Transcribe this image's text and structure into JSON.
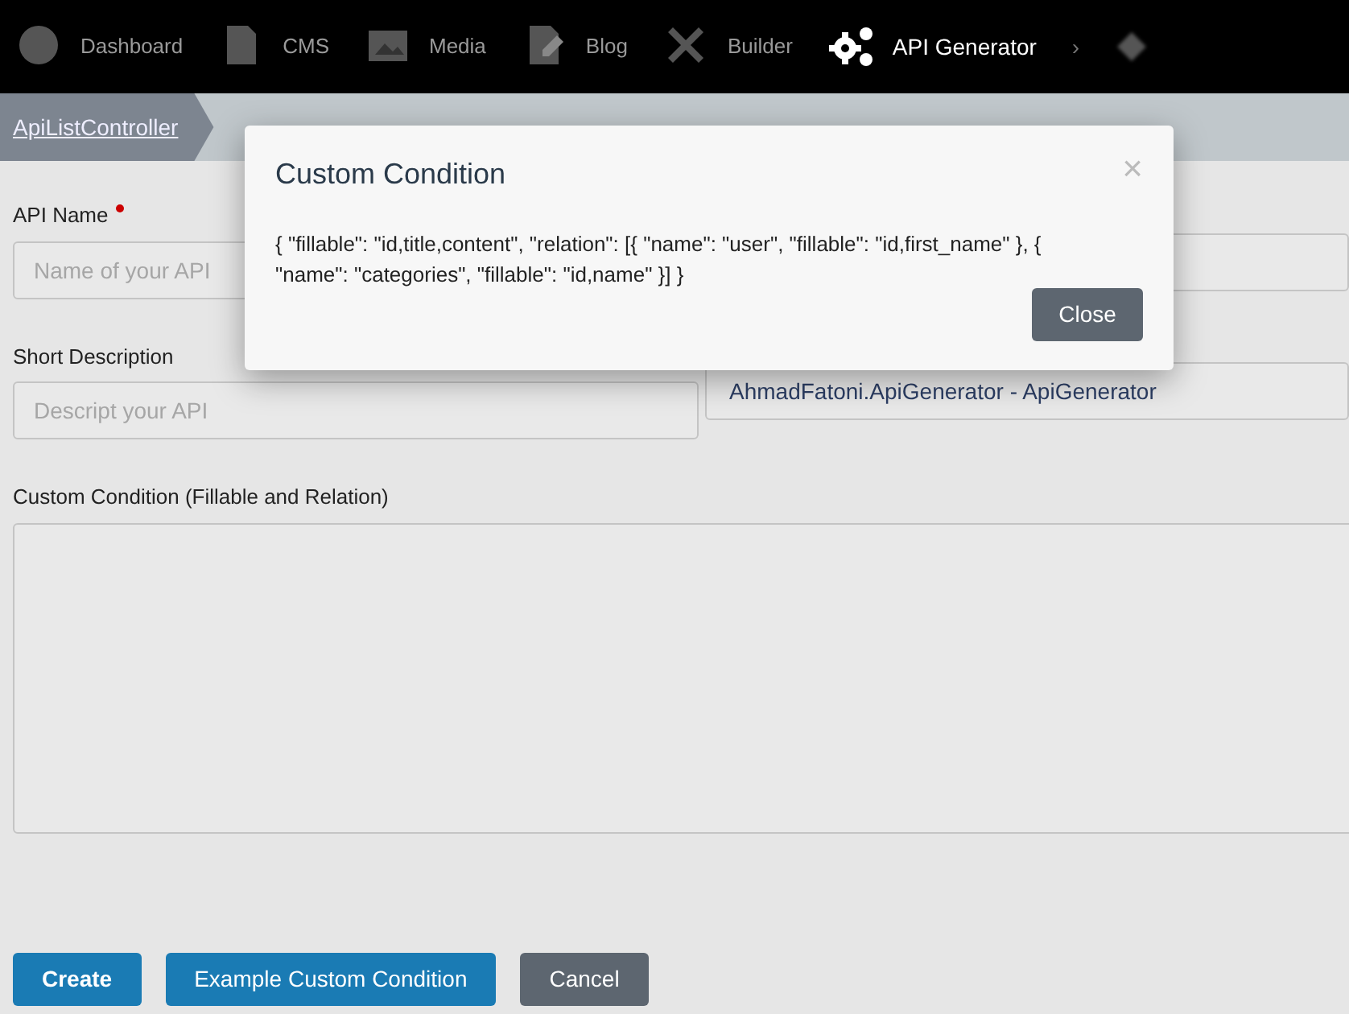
{
  "navbar": {
    "items": [
      {
        "label": "Dashboard",
        "selected": false
      },
      {
        "label": "CMS",
        "selected": false
      },
      {
        "label": "Media",
        "selected": false
      },
      {
        "label": "Blog",
        "selected": false
      },
      {
        "label": "Builder",
        "selected": false
      },
      {
        "label": "API Generator",
        "selected": true
      }
    ],
    "more": "›"
  },
  "breadcrumb": [
    "ApiListController"
  ],
  "form": {
    "left": [
      {
        "label": "API Name",
        "required": true,
        "placeholder": "Name of your API"
      },
      {
        "label": "Short Description",
        "required": false,
        "placeholder": "Descript your API"
      }
    ],
    "right_value": "AhmadFatoni.ApiGenerator - ApiGenerator",
    "textarea_label": "Custom Condition (Fillable and Relation)"
  },
  "buttons": [
    {
      "label": "Create",
      "kind": "primary"
    },
    {
      "label": "Example Custom Condition",
      "kind": "primary"
    },
    {
      "label": "Cancel",
      "kind": "secondary"
    }
  ],
  "modal": {
    "title": "Custom Condition",
    "close_icon": "×",
    "body": "{ \"fillable\": \"id,title,content\", \"relation\": [{ \"name\": \"user\", \"fillable\": \"id,first_name\" }, { \"name\": \"categories\", \"fillable\": \"id,name\" }] }",
    "button": "Close"
  }
}
